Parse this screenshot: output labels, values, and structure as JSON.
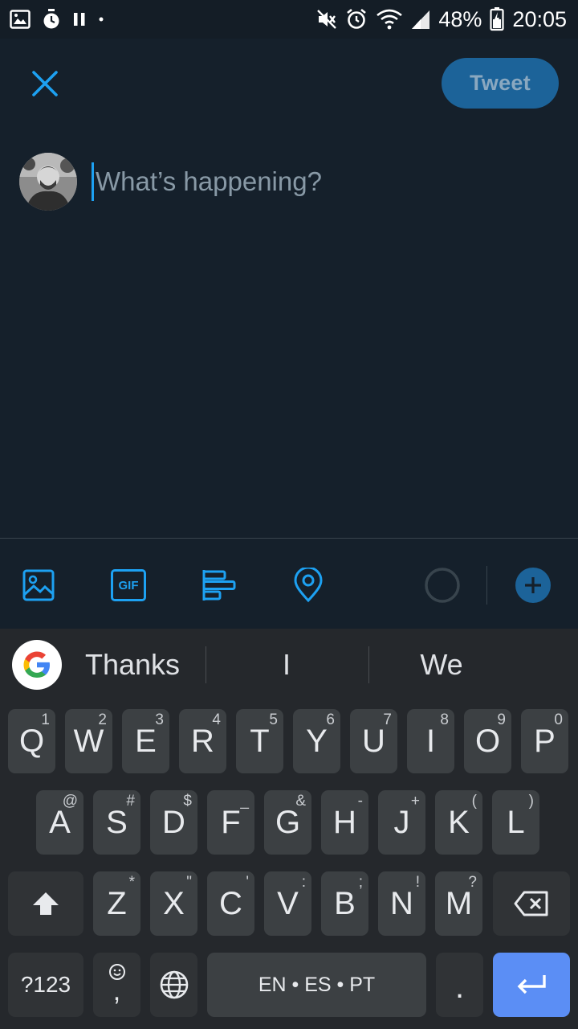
{
  "status_bar": {
    "battery": "48%",
    "time": "20:05"
  },
  "header": {
    "tweet_label": "Tweet"
  },
  "compose": {
    "placeholder": "What’s happening?"
  },
  "toolbar": {
    "icons": [
      "image-icon",
      "gif-icon",
      "poll-icon",
      "location-icon",
      "progress-circle",
      "add-icon"
    ],
    "gif_label": "GIF",
    "accent": "#1da1f2"
  },
  "keyboard": {
    "suggestions": [
      "Thanks",
      "I",
      "We"
    ],
    "row1": [
      {
        "k": "Q",
        "h": "1"
      },
      {
        "k": "W",
        "h": "2"
      },
      {
        "k": "E",
        "h": "3"
      },
      {
        "k": "R",
        "h": "4"
      },
      {
        "k": "T",
        "h": "5"
      },
      {
        "k": "Y",
        "h": "6"
      },
      {
        "k": "U",
        "h": "7"
      },
      {
        "k": "I",
        "h": "8"
      },
      {
        "k": "O",
        "h": "9"
      },
      {
        "k": "P",
        "h": "0"
      }
    ],
    "row2": [
      {
        "k": "A",
        "h": "@"
      },
      {
        "k": "S",
        "h": "#"
      },
      {
        "k": "D",
        "h": "$"
      },
      {
        "k": "F",
        "h": "_"
      },
      {
        "k": "G",
        "h": "&"
      },
      {
        "k": "H",
        "h": "-"
      },
      {
        "k": "J",
        "h": "+"
      },
      {
        "k": "K",
        "h": "("
      },
      {
        "k": "L",
        "h": ")"
      }
    ],
    "row3": [
      {
        "k": "Z",
        "h": "*"
      },
      {
        "k": "X",
        "h": "\""
      },
      {
        "k": "C",
        "h": "'"
      },
      {
        "k": "V",
        "h": ":"
      },
      {
        "k": "B",
        "h": ";"
      },
      {
        "k": "N",
        "h": "!"
      },
      {
        "k": "M",
        "h": "?"
      }
    ],
    "symbols_label": "?123",
    "comma_label": ",",
    "space_label": "EN • ES • PT",
    "period_label": ".",
    "enter_color": "#5b8ef5"
  }
}
